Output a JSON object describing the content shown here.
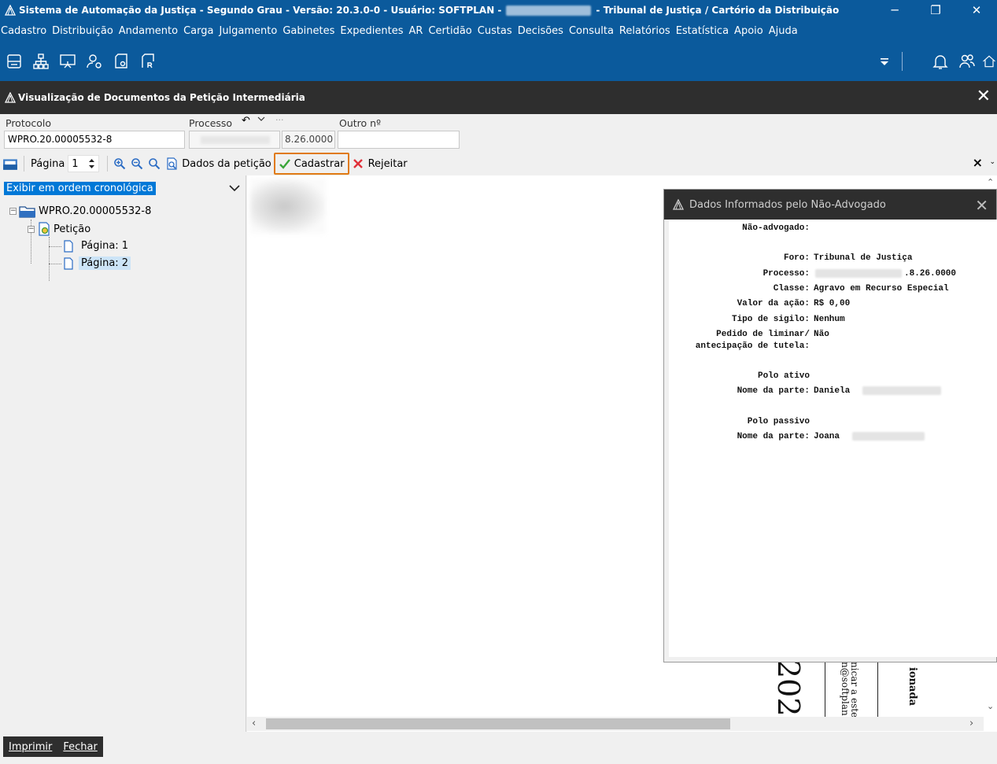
{
  "titlebar": {
    "part1": "Sistema de Automação da Justiça - Segundo Grau - Versão: 20.3.0-0 - Usuário: SOFTPLAN -",
    "part2": "- Tribunal de Justiça / Cartório da Distribuição",
    "minimize": "─",
    "restore": "❐",
    "close": "✕"
  },
  "menu": [
    "Cadastro",
    "Distribuição",
    "Andamento",
    "Carga",
    "Julgamento",
    "Gabinetes",
    "Expedientes",
    "AR",
    "Certidão",
    "Custas",
    "Decisões",
    "Consulta",
    "Relatórios",
    "Estatística",
    "Apoio",
    "Ajuda"
  ],
  "panel": {
    "title": "Visualização de Documentos da Petição Intermediária",
    "close": "✕"
  },
  "fields": {
    "protocolo_label": "Protocolo",
    "protocolo_value": "WPRO.20.00005532-8",
    "processo_label": "Processo",
    "processo_suffix": "8.26.0000",
    "outro_label": "Outro nº",
    "outro_value": "",
    "more": "···"
  },
  "toolbar": {
    "pagina_label": "Página",
    "pagina_value": "1",
    "dados_peticao": "Dados da petição",
    "cadastrar": "Cadastrar",
    "rejeitar": "Rejeitar",
    "close": "×"
  },
  "sort_option": "Exibir em ordem cronológica",
  "tree": {
    "root": "WPRO.20.00005532-8",
    "child": "Petição",
    "pages": [
      "Página: 1",
      "Página: 2"
    ]
  },
  "doc_fragments": {
    "year": "202",
    "note": "nicar a este\nn@softplan",
    "bold": "ionada"
  },
  "dialog": {
    "title": "Dados Informados pelo Não-Advogado",
    "close": "✕",
    "labels": {
      "nao_advogado": "Não-advogado:",
      "foro": "Foro:",
      "processo": "Processo:",
      "classe": "Classe:",
      "valor": "Valor da ação:",
      "sigilo": "Tipo de sigilo:",
      "liminar1": "Pedido de liminar/",
      "liminar2": "antecipação de tutela:",
      "polo_ativo": "Polo ativo",
      "nome_parte_ativo": "Nome da parte:",
      "polo_passivo": "Polo passivo",
      "nome_parte_passivo": "Nome da parte:"
    },
    "values": {
      "foro": "Tribunal de Justiça",
      "processo_suffix": ".8.26.0000",
      "classe": "Agravo em Recurso Especial",
      "valor": "R$ 0,00",
      "sigilo": "Nenhum",
      "liminar": "Não",
      "parte_ativo": "Daniela",
      "parte_passivo": "Joana"
    }
  },
  "bottom": {
    "imprimir": "Imprimir",
    "fechar": "Fechar"
  }
}
